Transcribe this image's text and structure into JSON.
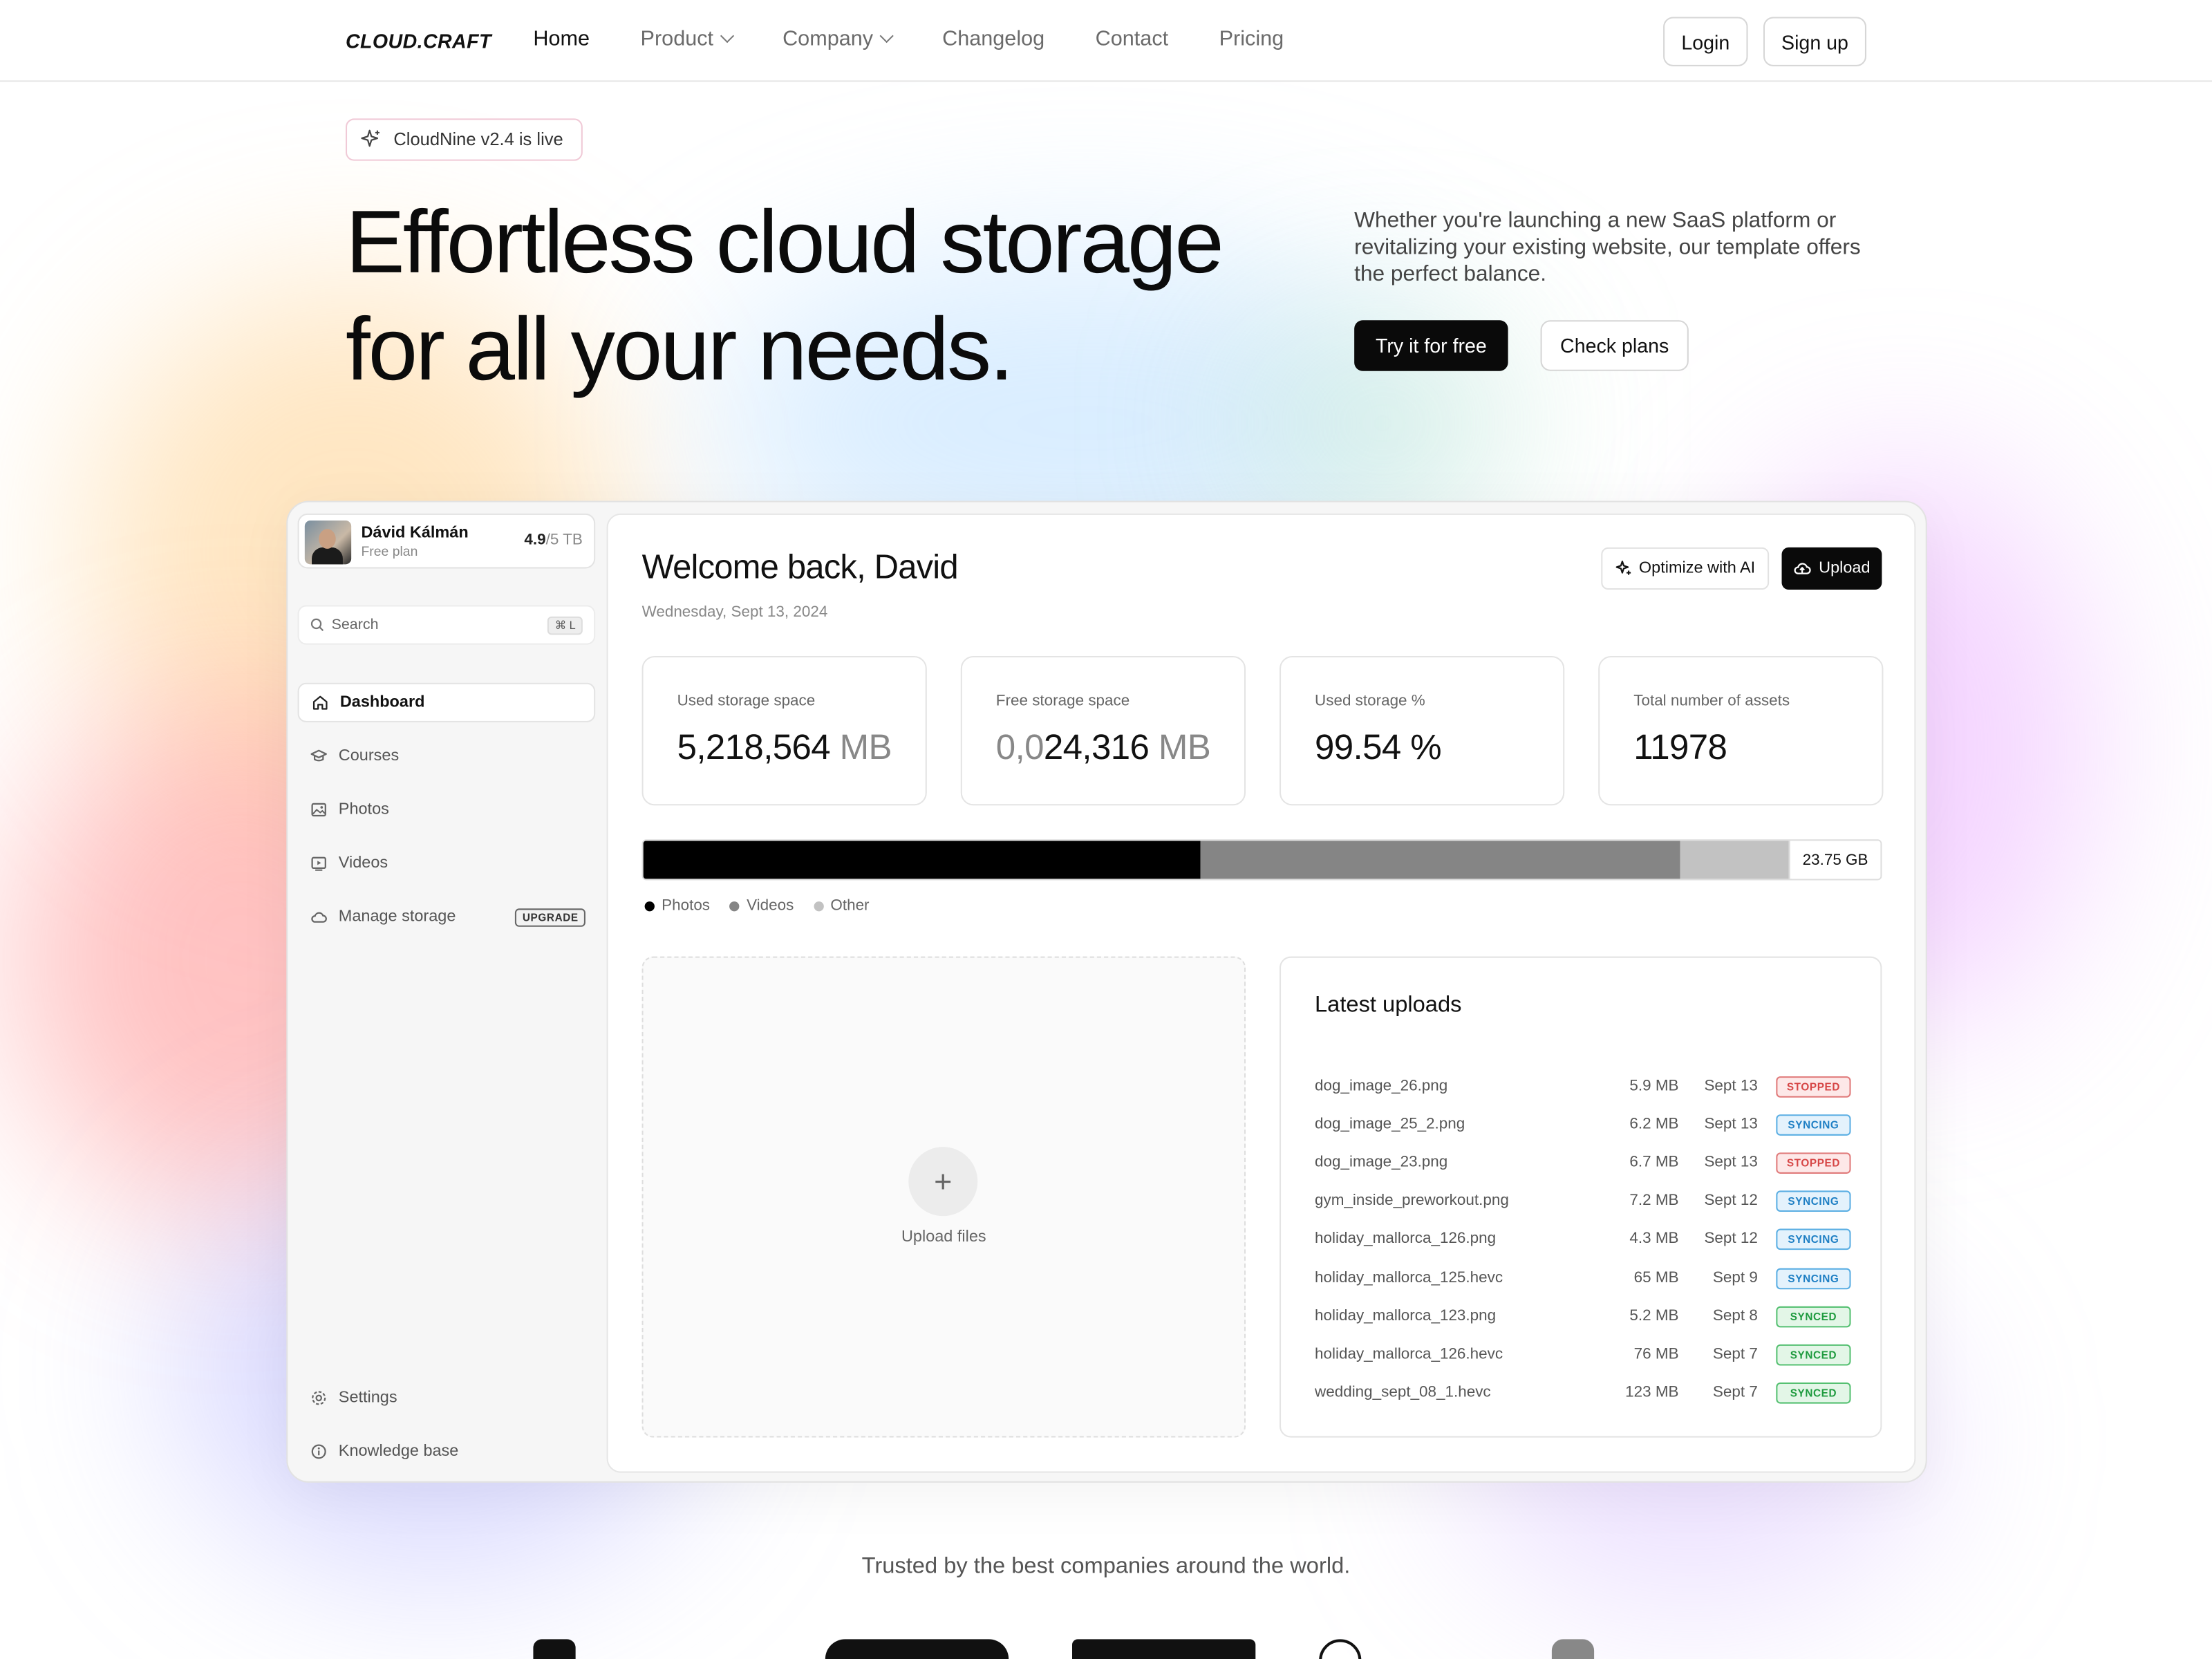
{
  "nav": {
    "logo": "CLOUD.CRAFT",
    "links": [
      "Home",
      "Product",
      "Company",
      "Changelog",
      "Contact",
      "Pricing"
    ],
    "login": "Login",
    "signup": "Sign up"
  },
  "hero": {
    "badge": "CloudNine v2.4 is live",
    "title_line1": "Effortless cloud storage",
    "title_line2": "for all your needs.",
    "subtitle": "Whether you're launching a new SaaS platform or revitalizing your existing website, our template offers the perfect balance.",
    "cta_primary": "Try it for free",
    "cta_secondary": "Check plans"
  },
  "sidebar": {
    "user_name": "Dávid Kálmán",
    "user_plan": "Free plan",
    "quota_used": "4.9",
    "quota_total": "/5 TB",
    "search_placeholder": "Search",
    "search_shortcut": "⌘ L",
    "items": [
      {
        "label": "Dashboard",
        "icon": "home-icon"
      },
      {
        "label": "Courses",
        "icon": "graduation-cap-icon"
      },
      {
        "label": "Photos",
        "icon": "image-icon"
      },
      {
        "label": "Videos",
        "icon": "video-icon"
      },
      {
        "label": "Manage storage",
        "icon": "cloud-icon",
        "badge": "UPGRADE"
      }
    ],
    "footer_items": [
      {
        "label": "Settings",
        "icon": "gear-icon"
      },
      {
        "label": "Knowledge base",
        "icon": "info-icon"
      }
    ]
  },
  "dashboard": {
    "title": "Welcome back, David",
    "date": "Wednesday, Sept 13, 2024",
    "optimize_label": "Optimize with AI",
    "upload_label": "Upload",
    "stats": [
      {
        "label": "Used storage space",
        "value": "5,218,564",
        "unit": " MB"
      },
      {
        "label": "Free storage space",
        "value_dim": "0,0",
        "value": "24,316",
        "unit": " MB"
      },
      {
        "label": "Used storage %",
        "value": "99.54 %",
        "unit": ""
      },
      {
        "label": "Total number of assets",
        "value": "11978",
        "unit": ""
      }
    ],
    "storage_bar": {
      "total_label": "23.75 GB",
      "segments": [
        {
          "name": "Photos",
          "fraction": 0.485,
          "color": "#000000"
        },
        {
          "name": "Videos",
          "fraction": 0.418,
          "color": "#858585"
        },
        {
          "name": "Other",
          "fraction": 0.097,
          "color": "#c2c2c2"
        }
      ]
    },
    "dropzone_label": "Upload files",
    "latest_title": "Latest uploads",
    "uploads": [
      {
        "file": "dog_image_26.png",
        "size": "5.9 MB",
        "date": "Sept 13",
        "status": "STOPPED"
      },
      {
        "file": "dog_image_25_2.png",
        "size": "6.2 MB",
        "date": "Sept 13",
        "status": "SYNCING"
      },
      {
        "file": "dog_image_23.png",
        "size": "6.7 MB",
        "date": "Sept 13",
        "status": "STOPPED"
      },
      {
        "file": "gym_inside_preworkout.png",
        "size": "7.2 MB",
        "date": "Sept 12",
        "status": "SYNCING"
      },
      {
        "file": "holiday_mallorca_126.png",
        "size": "4.3 MB",
        "date": "Sept 12",
        "status": "SYNCING"
      },
      {
        "file": "holiday_mallorca_125.hevc",
        "size": "65 MB",
        "date": "Sept 9",
        "status": "SYNCING"
      },
      {
        "file": "holiday_mallorca_123.png",
        "size": "5.2 MB",
        "date": "Sept 8",
        "status": "SYNCED"
      },
      {
        "file": "holiday_mallorca_126.hevc",
        "size": "76 MB",
        "date": "Sept 7",
        "status": "SYNCED"
      },
      {
        "file": "wedding_sept_08_1.hevc",
        "size": "123 MB",
        "date": "Sept 7",
        "status": "SYNCED"
      }
    ]
  },
  "trusted": "Trusted by the best companies around the world."
}
